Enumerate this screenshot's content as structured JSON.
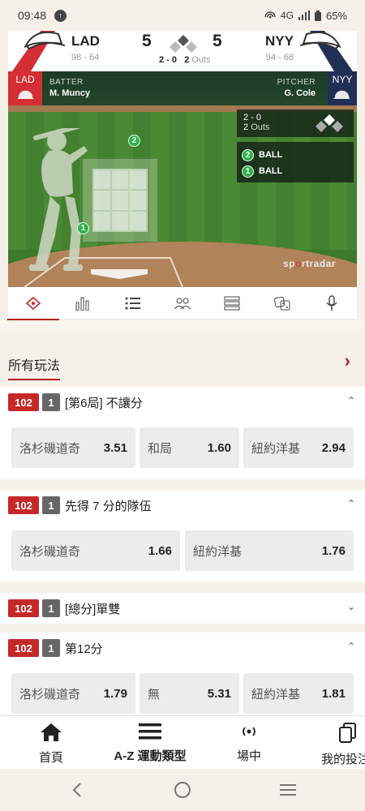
{
  "status": {
    "time": "09:48",
    "notif": "↑",
    "network": "4G",
    "battery": "65%"
  },
  "score": {
    "home": {
      "abbr": "LAD",
      "record": "98 - 64",
      "runs": "5"
    },
    "away": {
      "abbr": "NYY",
      "record": "94 - 68",
      "runs": "5"
    },
    "count": "2 - 0",
    "outs_num": "2",
    "outs_word": "Outs"
  },
  "field": {
    "batter_tag": "LAD",
    "batter_label": "BATTER",
    "batter_name": "M. Muncy",
    "pitcher_tag": "NYY",
    "pitcher_label": "PITCHER",
    "pitcher_name": "G. Cole",
    "count": "2 - 0",
    "outs_num": "2",
    "outs_word": "Outs",
    "pitches": [
      {
        "n": "2",
        "result": "BALL"
      },
      {
        "n": "1",
        "result": "BALL"
      }
    ],
    "brand_a": "sp",
    "brand_b": "o",
    "brand_c": "rtradar"
  },
  "all_bets": {
    "title": "所有玩法"
  },
  "markets": [
    {
      "code": "102",
      "period": "1",
      "title": "[第6局] 不讓分",
      "odds": [
        {
          "name": "洛杉磯道奇",
          "value": "3.51"
        },
        {
          "name": "和局",
          "value": "1.60"
        },
        {
          "name": "紐約洋基",
          "value": "2.94"
        }
      ]
    },
    {
      "code": "102",
      "period": "1",
      "title": "先得 7 分的隊伍",
      "odds": [
        {
          "name": "洛杉磯道奇",
          "value": "1.66"
        },
        {
          "name": "紐約洋基",
          "value": "1.76"
        }
      ]
    },
    {
      "code": "102",
      "period": "1",
      "title": "[總分]單雙"
    },
    {
      "code": "102",
      "period": "1",
      "title": "第12分",
      "odds": [
        {
          "name": "洛杉磯道奇",
          "value": "1.79"
        },
        {
          "name": "無",
          "value": "5.31"
        },
        {
          "name": "紐約洋基",
          "value": "1.81"
        }
      ]
    }
  ],
  "bottom_nav": [
    {
      "label": "首頁",
      "icon": "home-icon"
    },
    {
      "label": "A-Z 運動類型",
      "icon": "menu-icon"
    },
    {
      "label": "場中",
      "icon": "live-icon"
    },
    {
      "label": "我的投注",
      "icon": "bets-icon"
    }
  ],
  "colors": {
    "accent": "#b71c1c",
    "lad": "#d32f34",
    "nyy": "#1f2f55"
  }
}
